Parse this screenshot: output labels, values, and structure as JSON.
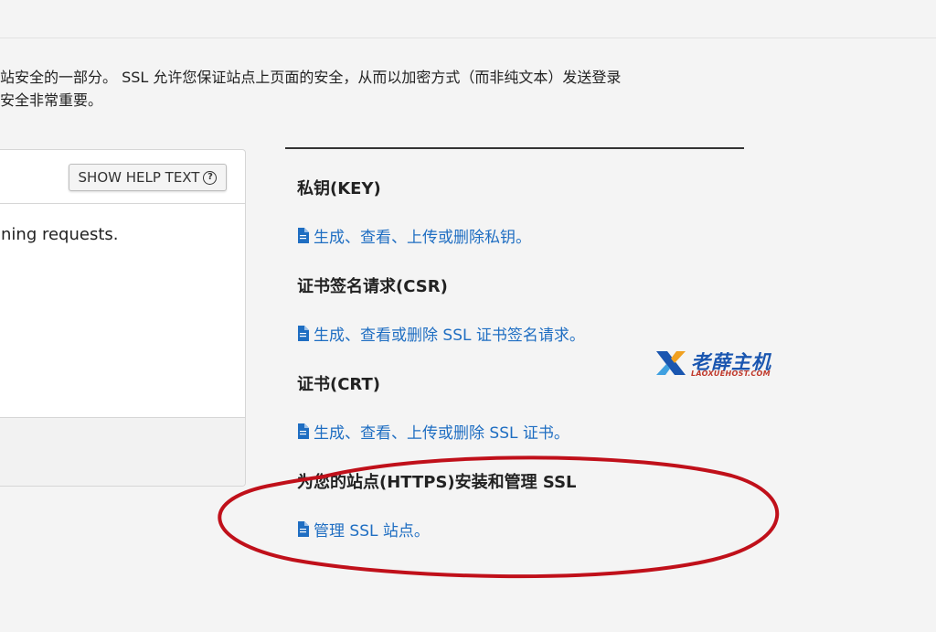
{
  "intro": {
    "line1": "站安全的一部分。 SSL 允许您保证站点上页面的安全，从而以加密方式（而非纯文本）发送登录",
    "line2": "安全非常重要。"
  },
  "left_panel": {
    "help_button": "SHOW HELP TEXT",
    "help_icon": "question-circle",
    "body_text": "ning requests."
  },
  "sections": [
    {
      "heading": "私钥(KEY)",
      "link": "生成、查看、上传或删除私钥。",
      "icon": "document"
    },
    {
      "heading": "证书签名请求(CSR)",
      "link": "生成、查看或删除 SSL 证书签名请求。",
      "icon": "document"
    },
    {
      "heading": "证书(CRT)",
      "link": "生成、查看、上传或删除 SSL 证书。",
      "icon": "document"
    },
    {
      "heading": "为您的站点(HTTPS)安装和管理 SSL",
      "link": "管理 SSL 站点。",
      "icon": "document"
    }
  ],
  "watermark": {
    "name": "老薛主机",
    "domain": "LAOXUEHOST.COM"
  },
  "colors": {
    "link": "#1f6ec2",
    "annotation": "#c0101a",
    "background": "#f4f4f4"
  }
}
